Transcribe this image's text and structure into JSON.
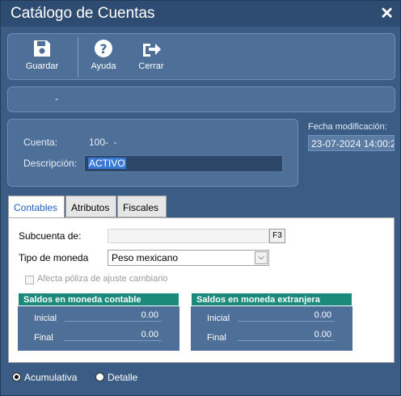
{
  "window": {
    "title": "Catálogo de Cuentas",
    "close_glyph": "✕"
  },
  "toolbar": {
    "save_label": "Guardar",
    "save_icon": "floppy-disk-icon",
    "help_label": "Ayuda",
    "help_icon": "question-circle-icon",
    "close_label": "Cerrar",
    "close_icon": "exit-arrow-icon"
  },
  "strip": {
    "text": "-"
  },
  "account": {
    "cuenta_label": "Cuenta:",
    "cuenta_value": "100-  -",
    "descripcion_label": "Descripción:",
    "descripcion_value": "ACTIVO"
  },
  "fecha": {
    "label": "Fecha modificación:",
    "value": "23-07-2024 14:00:2"
  },
  "tabs": [
    {
      "label": "Contables",
      "active": true
    },
    {
      "label": "Atributos",
      "active": false
    },
    {
      "label": "Fiscales",
      "active": false
    }
  ],
  "contables": {
    "subcuenta_label": "Subcuenta de:",
    "subcuenta_value": "",
    "f3_label": "F3",
    "tipo_moneda_label": "Tipo de moneda",
    "tipo_moneda_value": "Peso mexicano",
    "afecta_label": "Afecta póliza de ajuste cambiario",
    "afecta_checked": false
  },
  "saldos_contable": {
    "title": "Saldos en moneda contable",
    "inicial_label": "Inicial",
    "inicial_value": "0.00",
    "final_label": "Final",
    "final_value": "0.00"
  },
  "saldos_extranjera": {
    "title": "Saldos en moneda extranjera",
    "inicial_label": "Inicial",
    "inicial_value": "0.00",
    "final_label": "Final",
    "final_value": "0.00"
  },
  "tipo_cuenta": {
    "acumulativa_label": "Acumulativa",
    "detalle_label": "Detalle",
    "selected": "Acumulativa"
  },
  "colors": {
    "background": "#3b5c84",
    "panel": "#4d6f98",
    "saldo_header": "#1b8a7c"
  }
}
